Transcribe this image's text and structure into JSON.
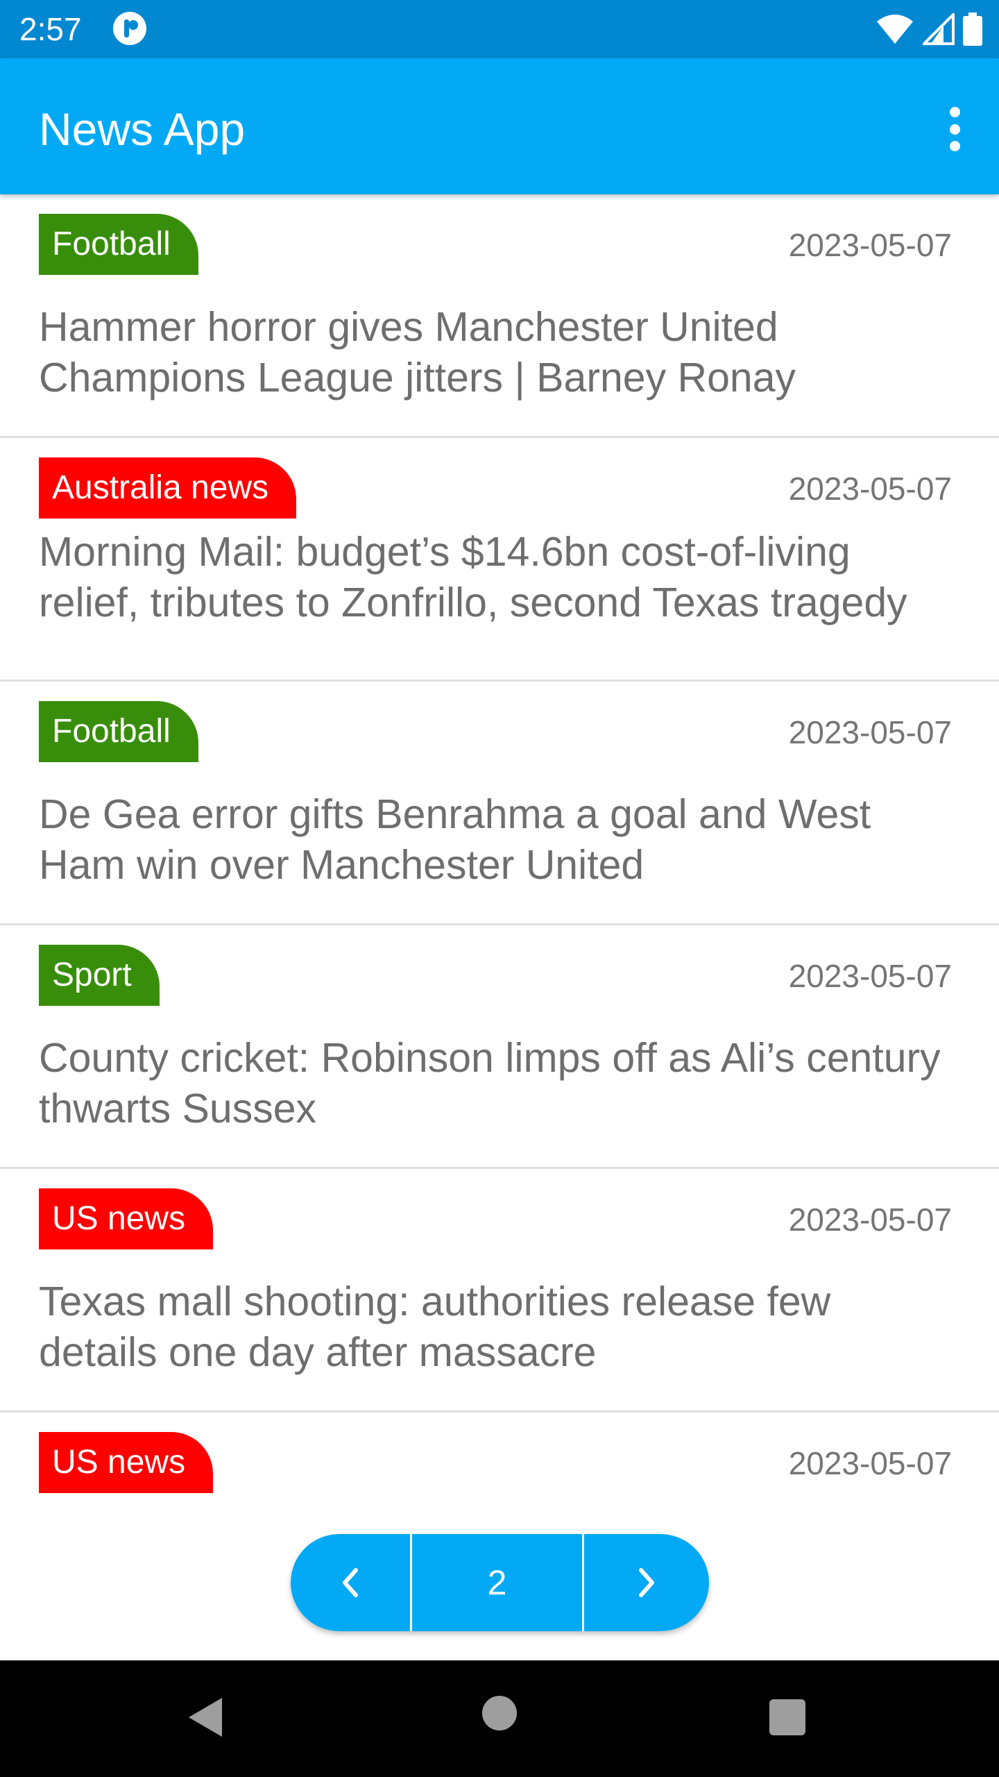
{
  "status_bar": {
    "time": "2:57",
    "icons": [
      "app-notification-icon",
      "wifi-icon",
      "signal-icon",
      "battery-icon"
    ]
  },
  "app_bar": {
    "title": "News App",
    "menu_icon": "more-vert-icon"
  },
  "articles": [
    {
      "category": "Football",
      "category_color": "#388e0a",
      "date": "2023-05-07",
      "title": "Hammer horror gives Manchester United Champions League jitters | Barney Ronay"
    },
    {
      "category": "Australia news",
      "category_color": "#ff0000",
      "date": "2023-05-07",
      "title": "Morning Mail: budget’s $14.6bn cost-of-living relief, tributes to Zonfrillo, second Texas tragedy"
    },
    {
      "category": "Football",
      "category_color": "#388e0a",
      "date": "2023-05-07",
      "title": "De Gea error gifts Benrahma a goal and West Ham win over Manchester United"
    },
    {
      "category": "Sport",
      "category_color": "#388e0a",
      "date": "2023-05-07",
      "title": "County cricket: Robinson limps off as Ali’s century thwarts Sussex"
    },
    {
      "category": "US news",
      "category_color": "#ff0000",
      "date": "2023-05-07",
      "title": "Texas mall shooting: authorities release few details one day after massacre"
    },
    {
      "category": "US news",
      "category_color": "#ff0000",
      "date": "2023-05-07",
      "title": ""
    }
  ],
  "pager": {
    "current_page": "2",
    "prev_icon": "chevron-left-icon",
    "next_icon": "chevron-right-icon"
  },
  "nav_bar": {
    "icons": [
      "back-icon",
      "home-icon",
      "recents-icon"
    ]
  },
  "colors": {
    "status_bar": "#0288d1",
    "app_bar": "#03a9f4",
    "green_tag": "#388e0a",
    "red_tag": "#ff0000"
  }
}
